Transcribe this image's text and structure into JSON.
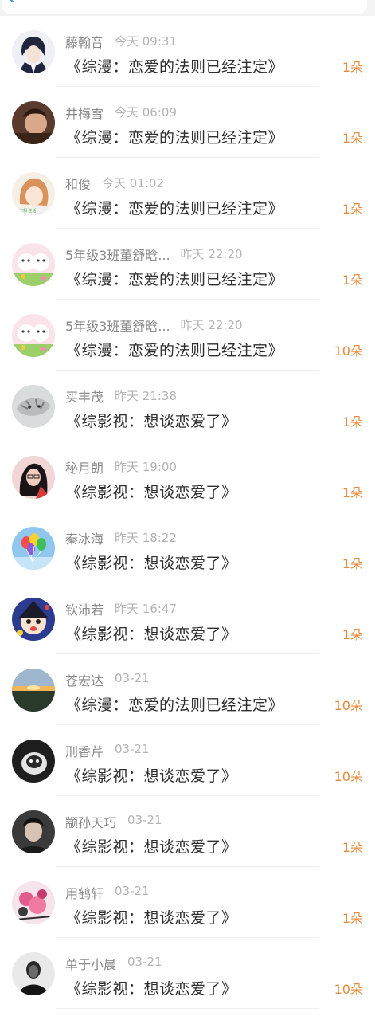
{
  "rows": [
    {
      "name": "藤翰音",
      "time": "今天 09:31",
      "title": "《综漫：恋爱的法则已经注定》",
      "amount": "1朵",
      "avatar": "anime-boy-avatar-icon"
    },
    {
      "name": "井梅雪",
      "time": "今天 06:09",
      "title": "《综漫：恋爱的法则已经注定》",
      "amount": "1朵",
      "avatar": "portrait-photo-avatar-icon"
    },
    {
      "name": "和俊",
      "time": "今天 01:02",
      "title": "《综漫：恋爱的法则已经注定》",
      "amount": "1朵",
      "avatar": "anime-girl-avatar-icon"
    },
    {
      "name": "5年级3班董舒晗...",
      "time": "昨天 22:20",
      "title": "《综漫：恋爱的法则已经注定》",
      "amount": "1朵",
      "avatar": "kittens-avatar-icon"
    },
    {
      "name": "5年级3班董舒晗...",
      "time": "昨天 22:20",
      "title": "《综漫：恋爱的法则已经注定》",
      "amount": "10朵",
      "avatar": "kittens-avatar-icon"
    },
    {
      "name": "买丰茂",
      "time": "昨天 21:38",
      "title": "《综影视：想谈恋爱了》",
      "amount": "1朵",
      "avatar": "tiger-sketch-avatar-icon"
    },
    {
      "name": "秘月朗",
      "time": "昨天 19:00",
      "title": "《综影视：想谈恋爱了》",
      "amount": "1朵",
      "avatar": "woman-portrait-avatar-icon"
    },
    {
      "name": "秦冰海",
      "time": "昨天 18:22",
      "title": "《综影视：想谈恋爱了》",
      "amount": "1朵",
      "avatar": "balloons-avatar-icon"
    },
    {
      "name": "钦沛若",
      "time": "昨天 16:47",
      "title": "《综影视：想谈恋爱了》",
      "amount": "1朵",
      "avatar": "cartoon-character-avatar-icon"
    },
    {
      "name": "苍宏达",
      "time": "03-21",
      "title": "《综漫：恋爱的法则已经注定》",
      "amount": "10朵",
      "avatar": "sunset-landscape-avatar-icon"
    },
    {
      "name": "刑香芹",
      "time": "03-21",
      "title": "《综影视：想谈恋爱了》",
      "amount": "10朵",
      "avatar": "dark-photo-avatar-icon"
    },
    {
      "name": "颛孙天巧",
      "time": "03-21",
      "title": "《综影视：想谈恋爱了》",
      "amount": "1朵",
      "avatar": "man-portrait-avatar-icon"
    },
    {
      "name": "用鹤轩",
      "time": "03-21",
      "title": "《综影视：想谈恋爱了》",
      "amount": "1朵",
      "avatar": "flower-art-avatar-icon"
    },
    {
      "name": "单于小晨",
      "time": "03-21",
      "title": "《综影视：想谈恋爱了》",
      "amount": "10朵",
      "avatar": "man-silhouette-avatar-icon"
    }
  ],
  "colors": {
    "amount": "#e68a3c",
    "name": "#8a8a8a",
    "time": "#b4b4b4",
    "title": "#2e2e2e",
    "accent_back": "#3b8fe0"
  }
}
